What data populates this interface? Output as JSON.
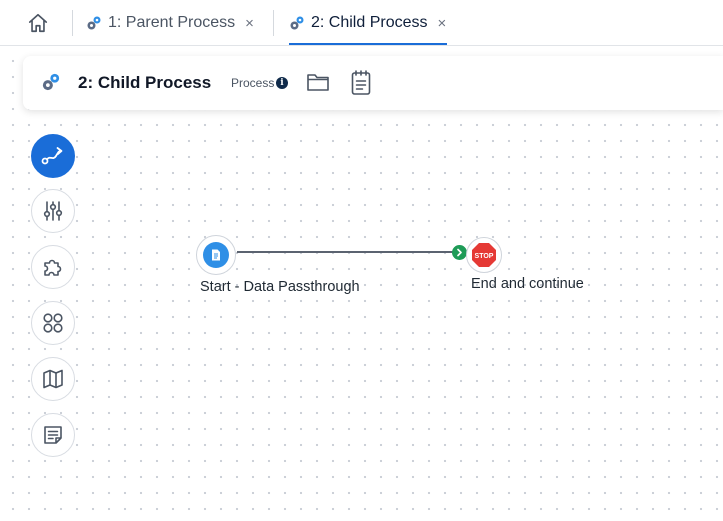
{
  "tabs": [
    {
      "label": "1: Parent Process",
      "icon": "gear-pair-icon",
      "close": "×",
      "active": false
    },
    {
      "label": "2: Child Process",
      "icon": "gear-pair-icon",
      "close": "×",
      "active": true
    }
  ],
  "header": {
    "title": "2: Child Process",
    "type_label": "Process",
    "info_symbol": "i"
  },
  "toolbar": [
    {
      "name": "flow-tool",
      "icon": "route-icon",
      "active": true
    },
    {
      "name": "settings-tool",
      "icon": "sliders-icon",
      "active": false
    },
    {
      "name": "plugins-tool",
      "icon": "puzzle-icon",
      "active": false
    },
    {
      "name": "components-tool",
      "icon": "four-circles-icon",
      "active": false
    },
    {
      "name": "map-tool",
      "icon": "map-icon",
      "active": false
    },
    {
      "name": "notes-tool",
      "icon": "note-icon",
      "active": false
    }
  ],
  "nodes": {
    "start": {
      "label": "Start - Data Passthrough",
      "icon": "document-icon"
    },
    "end": {
      "label": "End and continue",
      "icon": "stop-sign-icon",
      "stop_text": "STOP"
    }
  },
  "colors": {
    "accent": "#1a6dd8",
    "start_node": "#2f8fe6",
    "connector": "#1e9b57",
    "stop": "#e53935"
  }
}
